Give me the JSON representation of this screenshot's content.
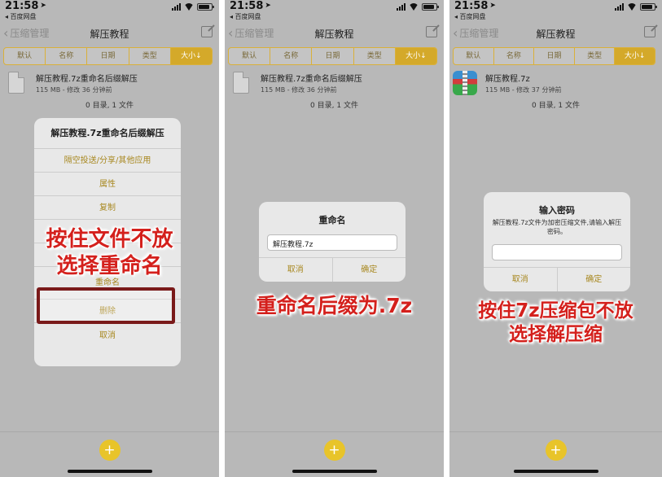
{
  "status": {
    "time": "21:58",
    "back_app": "◂ 百度网盘"
  },
  "nav": {
    "back_label": "压缩管理",
    "title": "解压教程"
  },
  "sort_tabs": [
    "默认",
    "名称",
    "日期",
    "类型",
    "大小↓"
  ],
  "panel1": {
    "file_name": "解压教程.7z重命名后缀解压",
    "file_meta": "115 MB - 修改 36 分钟前",
    "file_count": "0 目录, 1 文件",
    "sheet": {
      "title": "解压教程.7z重命名后缀解压",
      "items": [
        "隔空投送/分享/其他应用",
        "属性",
        "复制",
        "",
        "",
        "重命名",
        "删除",
        "取消"
      ]
    },
    "caption_line1": "按住文件不放",
    "caption_line2": "选择重命名"
  },
  "panel2": {
    "file_name": "解压教程.7z重命名后缀解压",
    "file_meta": "115 MB - 修改 36 分钟前",
    "file_count": "0 目录, 1 文件",
    "dialog": {
      "title": "重命名",
      "input_value": "解压教程.7z",
      "cancel": "取消",
      "confirm": "确定"
    },
    "caption": "重命名后缀为.7z"
  },
  "panel3": {
    "file_name": "解压教程.7z",
    "file_meta": "115 MB - 修改 37 分钟前",
    "file_count": "0 目录, 1 文件",
    "dialog": {
      "title": "输入密码",
      "message": "解压教程.7z文件为加密压缩文件,请输入解压密码。",
      "cancel": "取消",
      "confirm": "确定"
    },
    "caption_line1": "按住7z压缩包不放",
    "caption_line2": "选择解压缩"
  },
  "colors": {
    "accent": "#d4a92a",
    "caption_red": "#d4201c",
    "highlight_border": "#7a1a1a"
  }
}
